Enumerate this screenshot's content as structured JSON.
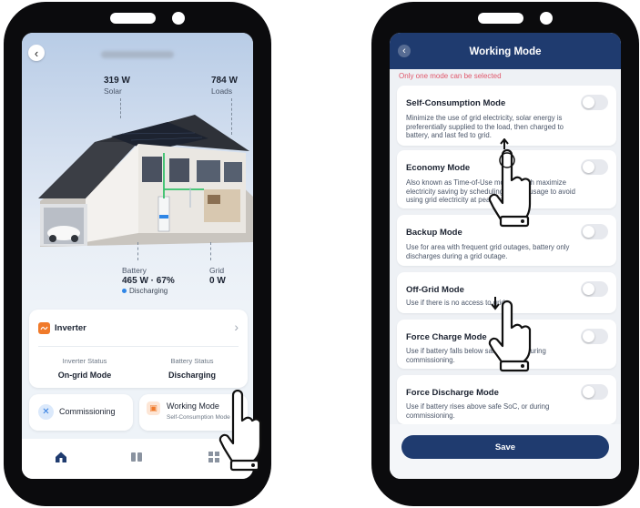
{
  "left_phone": {
    "header": {
      "back_icon": "chevron-left-icon"
    },
    "energy": {
      "solar": {
        "value": "319 W",
        "label": "Solar"
      },
      "loads": {
        "value": "784 W",
        "label": "Loads"
      },
      "battery": {
        "label": "Battery",
        "value": "465 W · 67%",
        "status": "Discharging"
      },
      "grid": {
        "label": "Grid",
        "value": "0 W"
      }
    },
    "inverter_card": {
      "title": "Inverter",
      "icon": "inverter-icon",
      "inverter_status_label": "Inverter Status",
      "inverter_status_value": "On-grid Mode",
      "battery_status_label": "Battery Status",
      "battery_status_value": "Discharging"
    },
    "tiles": {
      "commissioning": {
        "label": "Commissioning",
        "icon": "wrench-icon"
      },
      "working_mode": {
        "label": "Working Mode",
        "sub": "Self-Consumption Mode",
        "icon": "mode-icon"
      }
    },
    "tabbar": [
      "home-icon",
      "devices-icon",
      "apps-icon"
    ]
  },
  "right_phone": {
    "header": {
      "title": "Working Mode",
      "back_icon": "chevron-left-icon"
    },
    "warning": "Only one mode can be selected",
    "modes": [
      {
        "title": "Self-Consumption Mode",
        "desc": "Minimize the use of grid electricity, solar energy is preferentially supplied to the load, then charged to battery, and last fed to grid.",
        "enabled": false
      },
      {
        "title": "Economy Mode",
        "desc": "Also known as Time-of-Use mode, which maximize electricity saving by scheduling battery usage to avoid using grid electricity at peak times.",
        "enabled": false
      },
      {
        "title": "Backup Mode",
        "desc": "Use for area with frequent grid outages, battery only discharges during a grid outage.",
        "enabled": false
      },
      {
        "title": "Off-Grid Mode",
        "desc": "Use if there is no access to grid.",
        "enabled": false
      },
      {
        "title": "Force Charge Mode",
        "desc": "Use if battery falls below safe SoC, or during commissioning.",
        "enabled": false
      },
      {
        "title": "Force Discharge Mode",
        "desc": "Use if battery rises above safe SoC, or during commissioning.",
        "enabled": false
      }
    ],
    "save_label": "Save"
  },
  "colors": {
    "primary": "#1f3b6f",
    "accent": "#f07a2a",
    "warning": "#e0576b",
    "status_blue": "#2f86e6"
  }
}
